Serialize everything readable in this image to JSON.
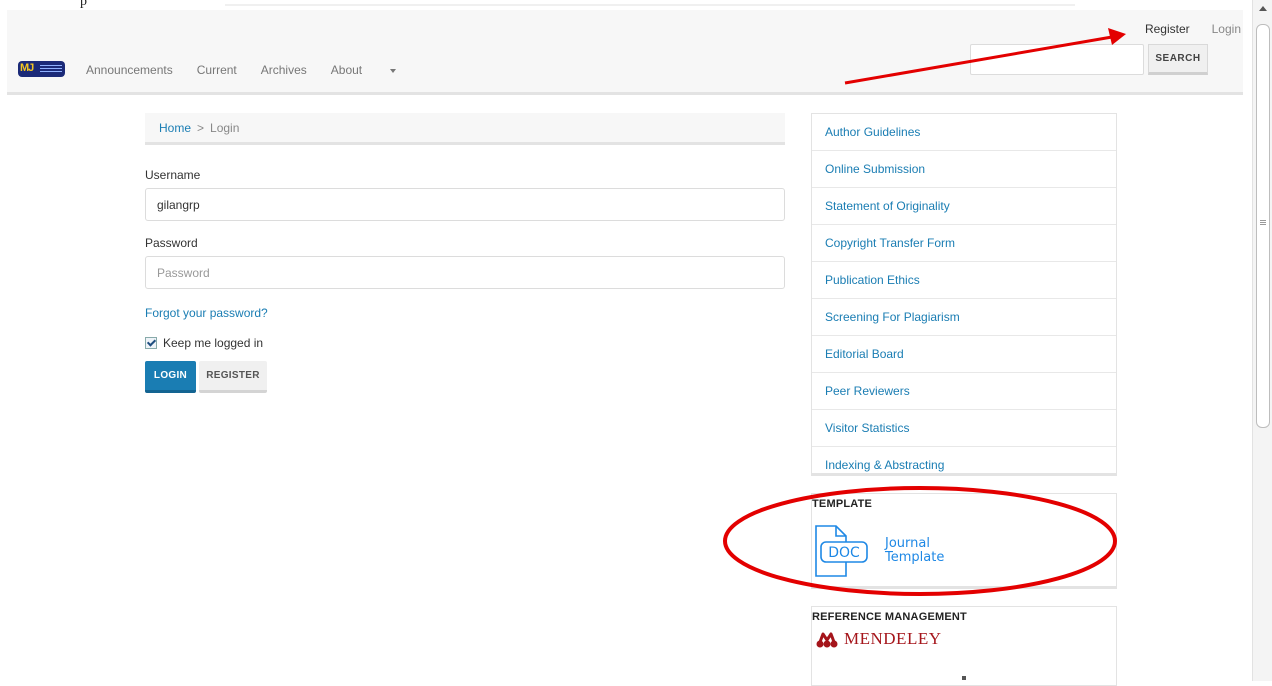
{
  "top_fragment": "p",
  "header": {
    "logo_text": "MJ",
    "user_nav": {
      "register": "Register",
      "login": "Login"
    },
    "nav": [
      {
        "label": "Announcements"
      },
      {
        "label": "Current"
      },
      {
        "label": "Archives"
      },
      {
        "label": "About"
      }
    ],
    "search": {
      "placeholder": "",
      "button_label": "SEARCH"
    }
  },
  "breadcrumb": {
    "home": "Home",
    "separator": ">",
    "current": "Login"
  },
  "form": {
    "username_label": "Username",
    "username_value": "gilangrp",
    "password_label": "Password",
    "password_placeholder": "Password",
    "forgot_link": "Forgot your password?",
    "keep_logged_label": "Keep me logged in",
    "keep_logged_checked": true,
    "login_button": "LOGIN",
    "register_button": "REGISTER"
  },
  "sidebar": {
    "links": [
      "Author Guidelines",
      "Online Submission",
      "Statement of Originality",
      "Copyright Transfer Form",
      "Publication Ethics",
      "Screening For Plagiarism",
      "Editorial Board",
      "Peer Reviewers",
      "Visitor Statistics",
      "Indexing & Abstracting"
    ],
    "template_block": {
      "title": "TEMPLATE",
      "doc_label": "DOC",
      "text_line1": "Journal",
      "text_line2": "Template"
    },
    "reference_block": {
      "title": "REFERENCE MANAGEMENT",
      "brand": "MENDELEY"
    }
  },
  "colors": {
    "link": "#1a7db3",
    "annotation_red": "#e30000",
    "doc_blue": "#1e88e5",
    "mendeley_red": "#a5151b"
  },
  "icons": [
    "doc-file-icon",
    "mendeley-logo-icon",
    "caret-down-icon",
    "checkmark-icon"
  ]
}
